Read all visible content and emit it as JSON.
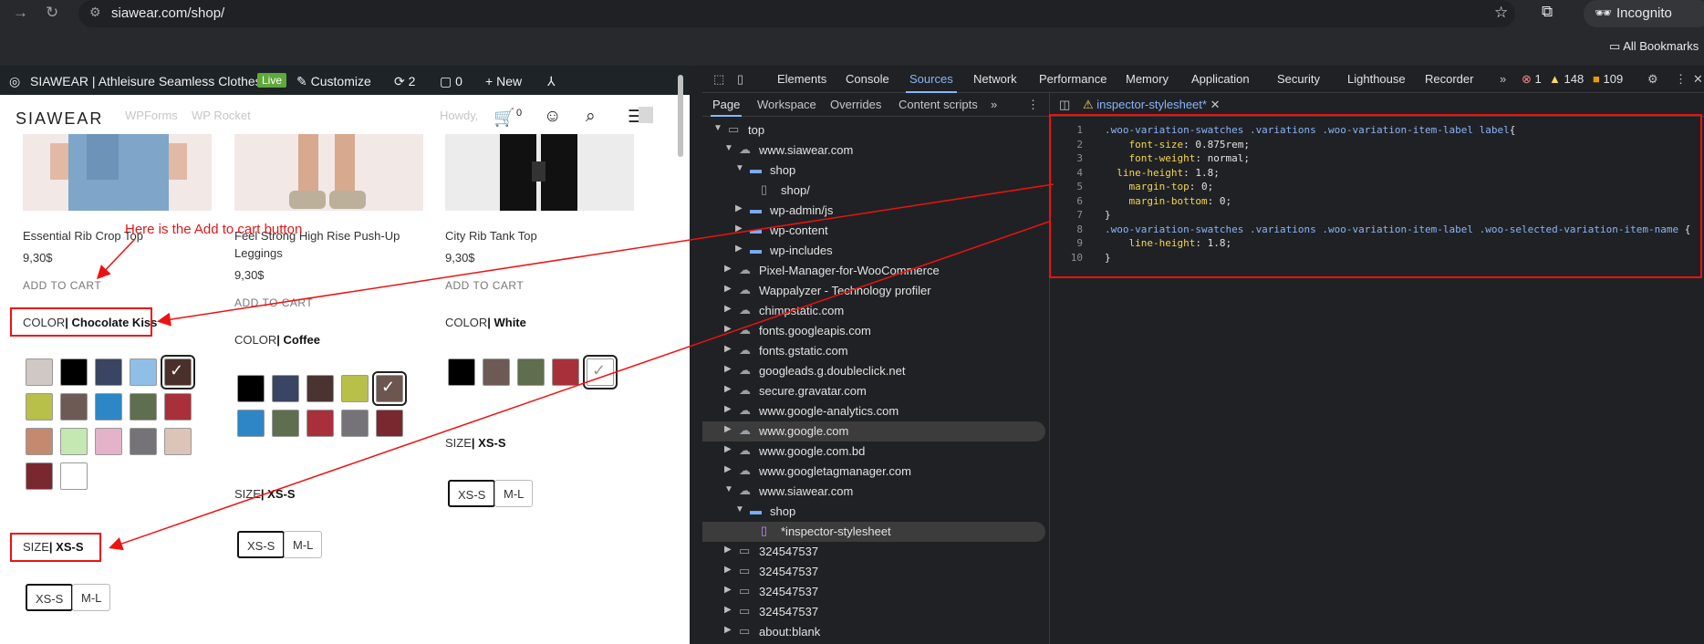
{
  "browser": {
    "url": "siawear.com/shop/",
    "incognito_label": "Incognito",
    "bookmarks_label": "All Bookmarks"
  },
  "admin_bar": {
    "site_name": "SIAWEAR | Athleisure Seamless Clothes",
    "live_badge": "Live",
    "customize": "Customize",
    "updates": "2",
    "comments": "0",
    "new": "New"
  },
  "header": {
    "logo": "SIAWEAR",
    "ghost_items": [
      "WPForms",
      "WP Rocket",
      "Howdy,"
    ],
    "cart_count": "0"
  },
  "annotation": {
    "text": "Here is the Add to cart button"
  },
  "products": [
    {
      "title": "Essential Rib Crop Top",
      "price": "9,30$",
      "add_to_cart": "ADD TO CART",
      "color_label": "COLOR",
      "color_value": "| Chocolate Kiss",
      "size_label": "SIZE",
      "size_value": "| XS-S",
      "sizes": [
        "XS-S",
        "M-L"
      ],
      "swatches": [
        "#d0c8c4",
        "#000000",
        "#3a4463",
        "#8fbfe6",
        "#4a2f2a",
        "#b8c04a",
        "#6e5a55",
        "#2d86c6",
        "#5f6e4f",
        "#a8303a",
        "#c48a70",
        "#c5e8b2",
        "#e4b2c9",
        "#767378",
        "#dcc4b8",
        "#7a2830",
        "#ffffff"
      ]
    },
    {
      "title": "Feel Strong High Rise Push-Up Leggings",
      "price": "9,30$",
      "add_to_cart": "ADD TO CART",
      "color_label": "COLOR",
      "color_value": "| Coffee",
      "size_label": "SIZE",
      "size_value": "| XS-S",
      "sizes": [
        "XS-S",
        "M-L"
      ],
      "swatches": [
        "#000000",
        "#3a4463",
        "#4a3432",
        "#b8c04a",
        "#6d5550",
        "#2d86c6",
        "#5f6e4f",
        "#a8303a",
        "#767378",
        "#7a2830"
      ]
    },
    {
      "title": "City Rib Tank Top",
      "price": "9,30$",
      "add_to_cart": "ADD TO CART",
      "color_label": "COLOR",
      "color_value": "| White",
      "size_label": "SIZE",
      "size_value": "| XS-S",
      "sizes": [
        "XS-S",
        "M-L"
      ],
      "swatches": [
        "#000000",
        "#6e5a55",
        "#5f6e4f",
        "#a8303a",
        "#ffffff"
      ]
    }
  ],
  "devtools": {
    "tabs": [
      "Elements",
      "Console",
      "Sources",
      "Network",
      "Performance",
      "Memory",
      "Application",
      "Security",
      "Lighthouse",
      "Recorder"
    ],
    "active_tab": "Sources",
    "errors": "1",
    "warnings": "148",
    "issues": "109",
    "sources_tabs": [
      "Page",
      "Workspace",
      "Overrides",
      "Content scripts"
    ],
    "editor_tab": "inspector-stylesheet*",
    "tree": [
      {
        "label": "top",
        "level": 0,
        "type": "frame",
        "open": true
      },
      {
        "label": "www.siawear.com",
        "level": 1,
        "type": "cloud",
        "open": true
      },
      {
        "label": "shop",
        "level": 2,
        "type": "folder",
        "open": true
      },
      {
        "label": "shop/",
        "level": 3,
        "type": "file"
      },
      {
        "label": "wp-admin/js",
        "level": 2,
        "type": "folder",
        "open": false
      },
      {
        "label": "wp-content",
        "level": 2,
        "type": "folder",
        "open": false
      },
      {
        "label": "wp-includes",
        "level": 2,
        "type": "folder",
        "open": false
      },
      {
        "label": "Pixel-Manager-for-WooCommerce",
        "level": 1,
        "type": "cloud",
        "open": false
      },
      {
        "label": "Wappalyzer - Technology profiler",
        "level": 1,
        "type": "cloud",
        "open": false
      },
      {
        "label": "chimpstatic.com",
        "level": 1,
        "type": "cloud",
        "open": false
      },
      {
        "label": "fonts.googleapis.com",
        "level": 1,
        "type": "cloud",
        "open": false
      },
      {
        "label": "fonts.gstatic.com",
        "level": 1,
        "type": "cloud",
        "open": false
      },
      {
        "label": "googleads.g.doubleclick.net",
        "level": 1,
        "type": "cloud",
        "open": false
      },
      {
        "label": "secure.gravatar.com",
        "level": 1,
        "type": "cloud",
        "open": false
      },
      {
        "label": "www.google-analytics.com",
        "level": 1,
        "type": "cloud",
        "open": false
      },
      {
        "label": "www.google.com",
        "level": 1,
        "type": "cloud",
        "open": false,
        "highlight": true
      },
      {
        "label": "www.google.com.bd",
        "level": 1,
        "type": "cloud",
        "open": false
      },
      {
        "label": "www.googletagmanager.com",
        "level": 1,
        "type": "cloud",
        "open": false
      },
      {
        "label": "www.siawear.com",
        "level": 1,
        "type": "cloud",
        "open": true
      },
      {
        "label": "shop",
        "level": 2,
        "type": "folder",
        "open": true
      },
      {
        "label": "*inspector-stylesheet",
        "level": 3,
        "type": "cssfile",
        "highlight": true
      },
      {
        "label": "324547537",
        "level": 1,
        "type": "frame",
        "open": false
      },
      {
        "label": "324547537",
        "level": 1,
        "type": "frame",
        "open": false
      },
      {
        "label": "324547537",
        "level": 1,
        "type": "frame",
        "open": false
      },
      {
        "label": "324547537",
        "level": 1,
        "type": "frame",
        "open": false
      },
      {
        "label": "about:blank",
        "level": 1,
        "type": "frame",
        "open": false
      }
    ],
    "code": [
      {
        "n": "1",
        "segs": [
          [
            "sel",
            ".woo-variation-swatches .variations .woo-variation-item-label label"
          ],
          [
            "val",
            "{"
          ]
        ]
      },
      {
        "n": "2",
        "segs": [
          [
            "val",
            "    "
          ],
          [
            "prop",
            "font-size"
          ],
          [
            "val",
            ": 0.875rem;"
          ]
        ]
      },
      {
        "n": "3",
        "segs": [
          [
            "val",
            "    "
          ],
          [
            "prop",
            "font-weight"
          ],
          [
            "val",
            ": normal;"
          ]
        ]
      },
      {
        "n": "4",
        "segs": [
          [
            "val",
            "  "
          ],
          [
            "prop",
            "line-height"
          ],
          [
            "val",
            ": 1.8;"
          ]
        ]
      },
      {
        "n": "5",
        "segs": [
          [
            "val",
            "    "
          ],
          [
            "prop",
            "margin-top"
          ],
          [
            "val",
            ": 0;"
          ]
        ]
      },
      {
        "n": "6",
        "segs": [
          [
            "val",
            "    "
          ],
          [
            "prop",
            "margin-bottom"
          ],
          [
            "val",
            ": 0;"
          ]
        ]
      },
      {
        "n": "7",
        "segs": [
          [
            "val",
            "}"
          ]
        ]
      },
      {
        "n": "8",
        "segs": [
          [
            "sel",
            ".woo-variation-swatches .variations .woo-variation-item-label .woo-selected-variation-item-name "
          ],
          [
            "val",
            "{"
          ]
        ]
      },
      {
        "n": "9",
        "segs": [
          [
            "val",
            "    "
          ],
          [
            "prop",
            "line-height"
          ],
          [
            "val",
            ": 1.8;"
          ]
        ]
      },
      {
        "n": "10",
        "segs": [
          [
            "val",
            "}"
          ]
        ]
      }
    ]
  }
}
